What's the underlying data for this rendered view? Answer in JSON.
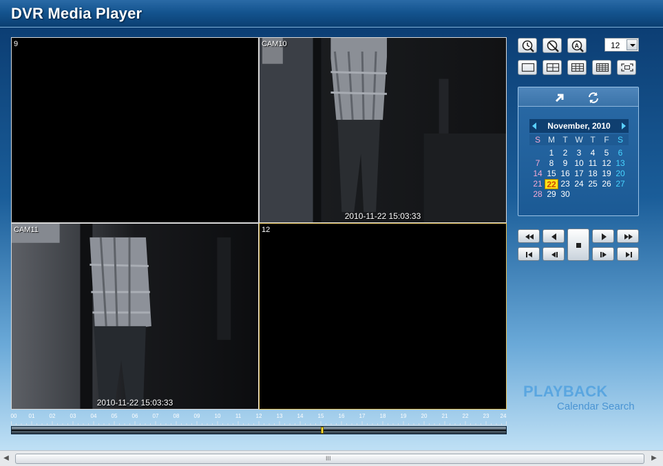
{
  "window": {
    "title": "DVR Media Player"
  },
  "tiles": [
    {
      "label": "9",
      "timestamp": "",
      "has_video": false
    },
    {
      "label": "CAM10",
      "timestamp": "2010-11-22 15:03:33",
      "has_video": true
    },
    {
      "label": "CAM11",
      "timestamp": "2010-11-22 15:03:33",
      "has_video": true
    },
    {
      "label": "12",
      "timestamp": "",
      "has_video": false
    }
  ],
  "timeline": {
    "hours": [
      "00",
      "01",
      "02",
      "03",
      "04",
      "05",
      "06",
      "07",
      "08",
      "09",
      "10",
      "11",
      "12",
      "13",
      "14",
      "15",
      "16",
      "17",
      "18",
      "19",
      "20",
      "21",
      "22",
      "23",
      "24"
    ],
    "current_hour": 15.06
  },
  "toolbar": {
    "icons": [
      "clock-search-icon",
      "no-event-search-icon",
      "text-search-icon"
    ],
    "layout_icons": [
      "layout-1x1-icon",
      "layout-2x2-icon",
      "layout-3x3-icon",
      "layout-4x4-icon",
      "fullscreen-icon"
    ],
    "channel_count": "12"
  },
  "calendar": {
    "header_icons": [
      "export-arrow-icon",
      "refresh-icon"
    ],
    "month_label": "November, 2010",
    "dow": [
      "S",
      "M",
      "T",
      "W",
      "T",
      "F",
      "S"
    ],
    "first_weekday": 1,
    "days_in_month": 30,
    "selected_day": 22,
    "days": [
      "1",
      "2",
      "3",
      "4",
      "5",
      "6",
      "7",
      "8",
      "9",
      "10",
      "11",
      "12",
      "13",
      "14",
      "15",
      "16",
      "17",
      "18",
      "19",
      "20",
      "21",
      "22",
      "23",
      "24",
      "25",
      "26",
      "27",
      "28",
      "29",
      "30"
    ]
  },
  "playback": {
    "buttons": [
      "fast-rewind",
      "rewind",
      "stop",
      "play",
      "fast-forward",
      "first-frame",
      "step-back",
      "step-forward",
      "last-frame"
    ]
  },
  "branding": {
    "line1": "PLAYBACK",
    "line2": "Calendar Search"
  },
  "scrollbar": {
    "grip": "III"
  }
}
